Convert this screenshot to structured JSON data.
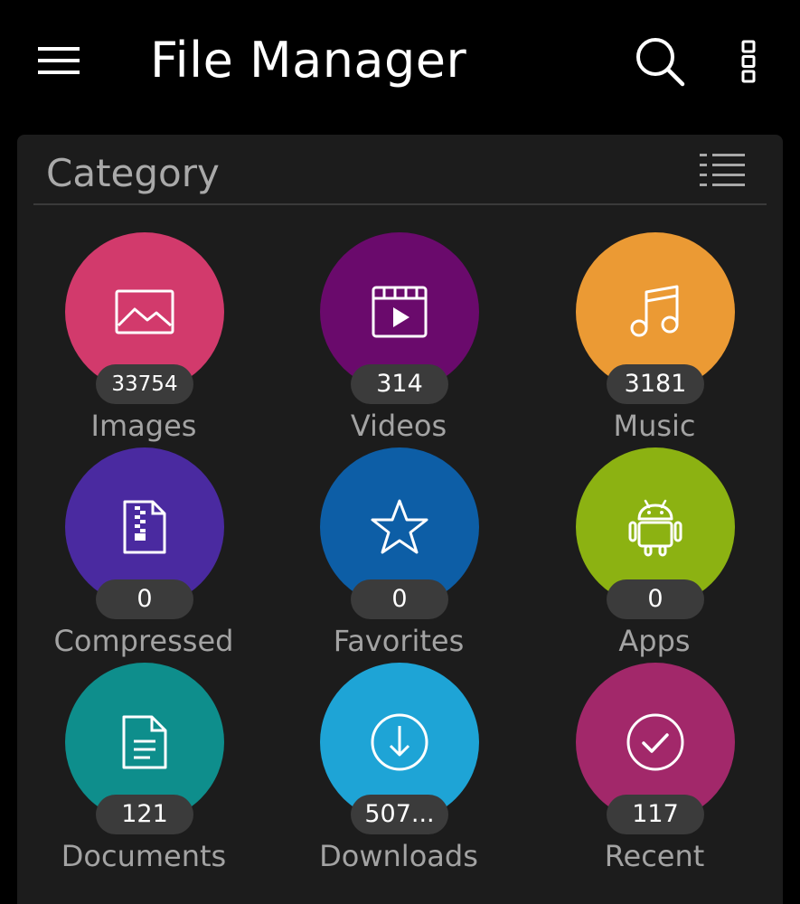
{
  "app_bar": {
    "title": "File Manager",
    "icons": {
      "menu": "hamburger-menu-icon",
      "search": "search-icon",
      "more": "more-vert-icon"
    }
  },
  "category": {
    "title": "Category",
    "view_toggle_icon": "list-view-icon",
    "items": [
      {
        "label": "Images",
        "count": "33754",
        "color": "#d23a6c",
        "icon": "image-icon"
      },
      {
        "label": "Videos",
        "count": "314",
        "color": "#6a0a6c",
        "icon": "video-icon"
      },
      {
        "label": "Music",
        "count": "3181",
        "color": "#eb9a34",
        "icon": "music-icon"
      },
      {
        "label": "Compressed",
        "count": "0",
        "color": "#4a2aa0",
        "icon": "zip-file-icon"
      },
      {
        "label": "Favorites",
        "count": "0",
        "color": "#0d5ea6",
        "icon": "star-icon"
      },
      {
        "label": "Apps",
        "count": "0",
        "color": "#8cb212",
        "icon": "android-icon"
      },
      {
        "label": "Documents",
        "count": "121",
        "color": "#0e8e8c",
        "icon": "document-icon"
      },
      {
        "label": "Downloads",
        "count": "507...",
        "color": "#1ea4d6",
        "icon": "download-icon"
      },
      {
        "label": "Recent",
        "count": "117",
        "color": "#a2286a",
        "icon": "check-circle-icon"
      }
    ]
  }
}
